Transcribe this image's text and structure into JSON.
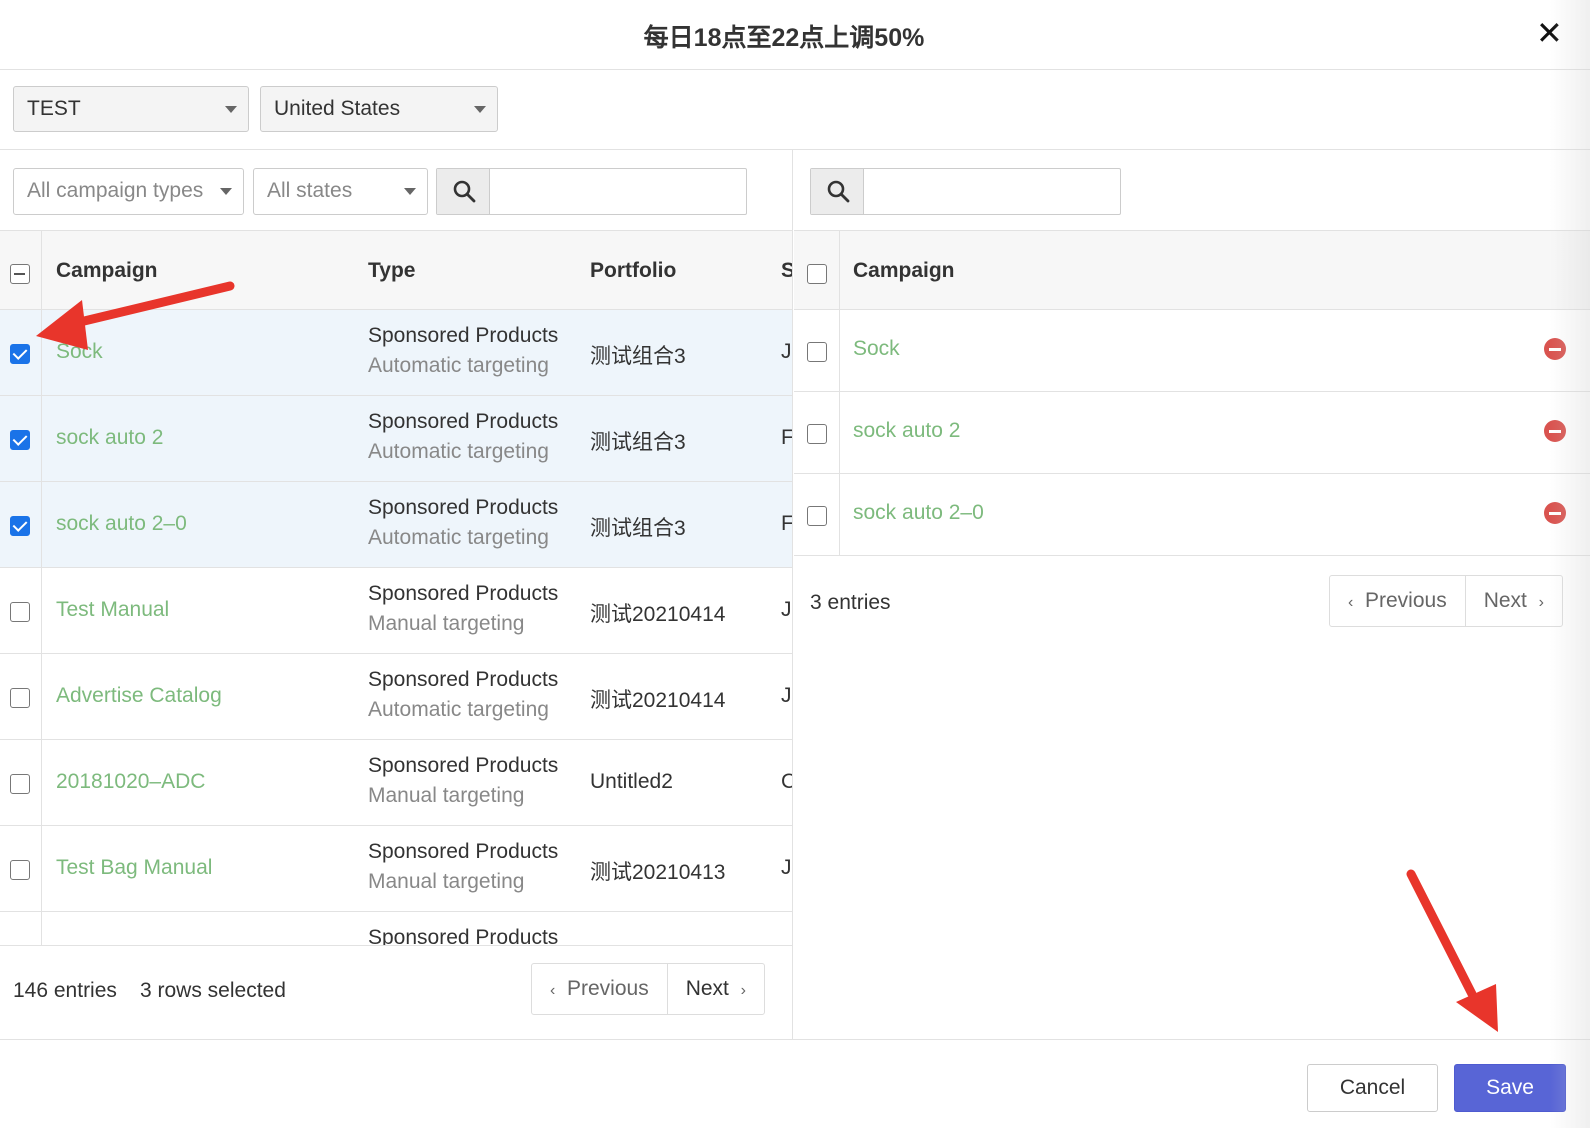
{
  "header": {
    "title": "每日18点至22点上调50%",
    "close_label": "✕"
  },
  "filters": {
    "account": "TEST",
    "country": "United States",
    "campaign_type": "All campaign types",
    "state": "All states"
  },
  "left_table": {
    "columns": {
      "campaign": "Campaign",
      "type": "Type",
      "portfolio": "Portfolio",
      "s": "S"
    },
    "rows": [
      {
        "campaign": "Sock",
        "type_main": "Sponsored Products",
        "type_sub": "Automatic targeting",
        "portfolio": "测试组合3",
        "s": "J",
        "checked": true
      },
      {
        "campaign": "sock auto 2",
        "type_main": "Sponsored Products",
        "type_sub": "Automatic targeting",
        "portfolio": "测试组合3",
        "s": "F",
        "checked": true
      },
      {
        "campaign": "sock auto 2–0",
        "type_main": "Sponsored Products",
        "type_sub": "Automatic targeting",
        "portfolio": "测试组合3",
        "s": "F",
        "checked": true
      },
      {
        "campaign": "Test Manual",
        "type_main": "Sponsored Products",
        "type_sub": "Manual targeting",
        "portfolio": "测试20210414",
        "s": "J",
        "checked": false
      },
      {
        "campaign": "Advertise Catalog",
        "type_main": "Sponsored Products",
        "type_sub": "Automatic targeting",
        "portfolio": "测试20210414",
        "s": "J",
        "checked": false
      },
      {
        "campaign": "20181020–ADC",
        "type_main": "Sponsored Products",
        "type_sub": "Manual targeting",
        "portfolio": "Untitled2",
        "s": "C",
        "checked": false
      },
      {
        "campaign": "Test Bag Manual",
        "type_main": "Sponsored Products",
        "type_sub": "Manual targeting",
        "portfolio": "测试20210413",
        "s": "J",
        "checked": false
      },
      {
        "campaign": "",
        "type_main": "Sponsored Products",
        "type_sub": "",
        "portfolio": "",
        "s": "",
        "checked": false
      }
    ],
    "footer": {
      "entries": "146 entries",
      "selected": "3 rows selected"
    },
    "pager": {
      "previous": "Previous",
      "next": "Next"
    }
  },
  "right_table": {
    "columns": {
      "campaign": "Campaign"
    },
    "rows": [
      {
        "campaign": "Sock"
      },
      {
        "campaign": "sock auto 2"
      },
      {
        "campaign": "sock auto 2–0"
      }
    ],
    "footer": {
      "entries": "3 entries"
    },
    "pager": {
      "previous": "Previous",
      "next": "Next"
    }
  },
  "actions": {
    "cancel": "Cancel",
    "save": "Save"
  },
  "colors": {
    "link": "#7dba7d",
    "primary": "#5865d6",
    "danger": "#d9534f",
    "arrow": "#e8352b",
    "checkbox": "#1a73e8"
  }
}
